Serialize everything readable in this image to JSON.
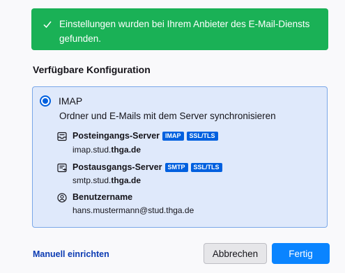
{
  "banner": {
    "text": "Einstellungen wurden bei Ihrem Anbieter des E-Mail-Diensts gefunden."
  },
  "section_title": "Verfügbare Konfiguration",
  "config": {
    "protocol": "IMAP",
    "description": "Ordner und E-Mails mit dem Server synchronisieren",
    "incoming": {
      "label": "Posteingangs-Server",
      "badges": [
        "IMAP",
        "SSL/TLS"
      ],
      "host_prefix": "imap.stud.",
      "host_bold": "thga.de"
    },
    "outgoing": {
      "label": "Postausgangs-Server",
      "badges": [
        "SMTP",
        "SSL/TLS"
      ],
      "host_prefix": "smtp.stud.",
      "host_bold": "thga.de"
    },
    "username": {
      "label": "Benutzername",
      "value": "hans.mustermann@stud.thga.de"
    }
  },
  "footer": {
    "manual_link": "Manuell einrichten",
    "cancel_label": "Abbrechen",
    "ok_label": "Fertig"
  },
  "colors": {
    "success": "#1ab156",
    "accent": "#0060df",
    "primary_button": "#0a84ff",
    "config_bg": "#dfe9fb",
    "link": "#0b3bb3"
  }
}
